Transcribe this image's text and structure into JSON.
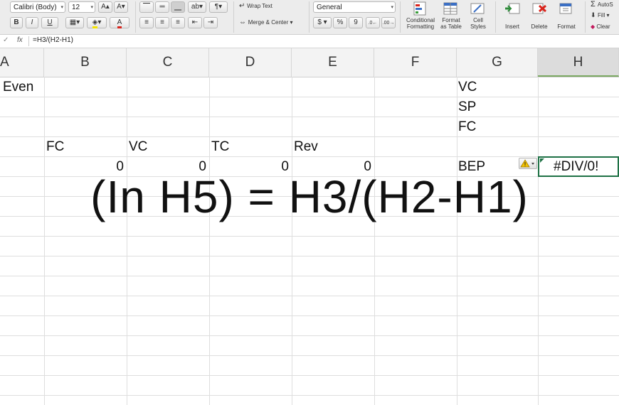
{
  "ribbon": {
    "font_name": "Calibri (Body)",
    "font_size": "12",
    "bold": "B",
    "italic": "I",
    "underline": "U",
    "font_color_glyph": "A",
    "wrap_text": "Wrap Text",
    "merge_center": "Merge & Center",
    "number_format": "General",
    "currency": "$",
    "percent": "%",
    "comma": "9",
    "conditional_formatting": [
      "Conditional",
      "Formatting"
    ],
    "format_as_table": [
      "Format",
      "as Table"
    ],
    "cell_styles": [
      "Cell",
      "Styles"
    ],
    "insert": "Insert",
    "delete": "Delete",
    "format": "Format",
    "autosum": "AutoS",
    "fill": "Fill",
    "clear": "Clear",
    "accent_color": "#1e7145"
  },
  "formula_bar": {
    "check_glyph": "✓",
    "fx": "fx",
    "formula": "=H3/(H2-H1)"
  },
  "columns": [
    "A",
    "B",
    "C",
    "D",
    "E",
    "F",
    "G",
    "H"
  ],
  "cells": {
    "A1": "Even",
    "G1": "VC",
    "G2": "SP",
    "G3": "FC",
    "B4": "FC",
    "C4": "VC",
    "D4": "TC",
    "E4": "Rev",
    "B5": "0",
    "C5": "0",
    "D5": "0",
    "E5": "0",
    "G5": "BEP",
    "H5": "#DIV/0!"
  },
  "overlay_text": "(In H5) = H3/(H2-H1)"
}
